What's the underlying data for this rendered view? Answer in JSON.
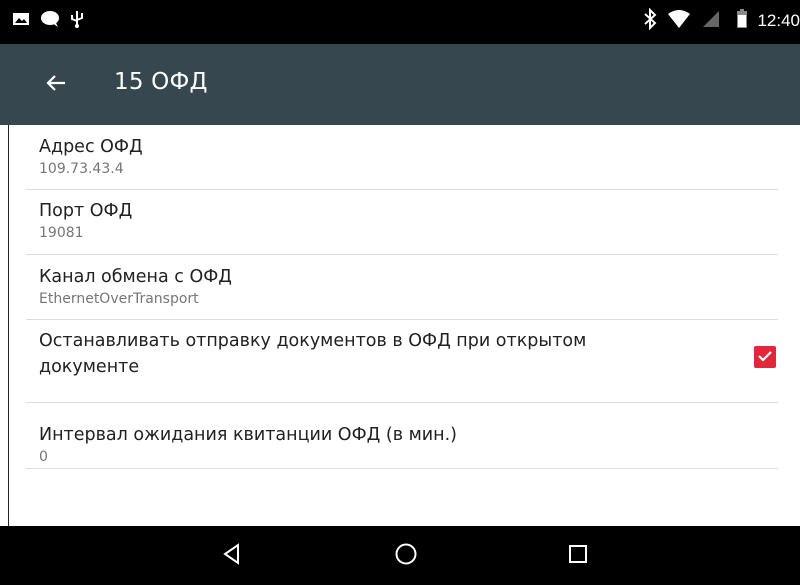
{
  "status_bar": {
    "time": "12:40",
    "icons": [
      "image-icon",
      "chat-bubble-icon",
      "usb-icon",
      "bluetooth-icon",
      "wifi-icon",
      "no-signal-icon",
      "battery-icon"
    ]
  },
  "app_bar": {
    "title": "15 ОФД",
    "back_icon": "arrow-back-icon"
  },
  "preferences": [
    {
      "title": "Адрес ОФД",
      "summary": "109.73.43.4"
    },
    {
      "title": "Порт ОФД",
      "summary": "19081"
    },
    {
      "title": "Канал обмена с ОФД",
      "summary": "EthernetOverTransport"
    },
    {
      "title": "Останавливать отправку документов в ОФД при открытом документе",
      "checked": true
    },
    {
      "title": "Интервал ожидания квитанции ОФД (в мин.)",
      "summary": "0"
    }
  ],
  "colors": {
    "status_bar": "#000000",
    "app_bar": "#37474f",
    "accent": "#e0283a",
    "nav_bar": "#000000"
  },
  "nav_bar": {
    "icons": [
      "back-triangle-icon",
      "home-circle-icon",
      "recents-square-icon"
    ]
  }
}
